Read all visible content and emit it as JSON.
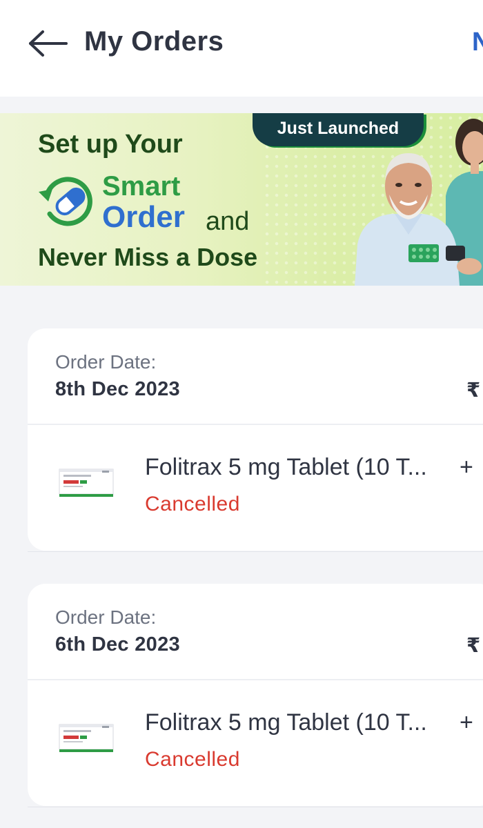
{
  "header": {
    "title": "My Orders",
    "action_label": "N",
    "back_icon": "arrow-left-icon"
  },
  "banner": {
    "tag": "Just Launched",
    "line1": "Set up Your",
    "smart": "Smart",
    "order": "Order",
    "and": "and",
    "line3": "Never Miss a Dose",
    "icon": "refill-capsule-icon",
    "colors": {
      "tag_bg": "#153d45",
      "smart": "#2e9c45",
      "order": "#2f6fcf",
      "text": "#1f4a1a"
    }
  },
  "orders": [
    {
      "date_label": "Order Date:",
      "date": "8th Dec 2023",
      "price_symbol": "₹",
      "product_name": "Folitrax 5 mg Tablet (10 T...",
      "more_items": "+",
      "status": "Cancelled"
    },
    {
      "date_label": "Order Date:",
      "date": "6th Dec 2023",
      "price_symbol": "₹",
      "product_name": "Folitrax 5 mg Tablet (10 T...",
      "more_items": "+",
      "status": "Cancelled"
    }
  ],
  "colors": {
    "background": "#f3f4f7",
    "status_cancelled": "#d93a2f",
    "accent": "#2d64c8"
  }
}
